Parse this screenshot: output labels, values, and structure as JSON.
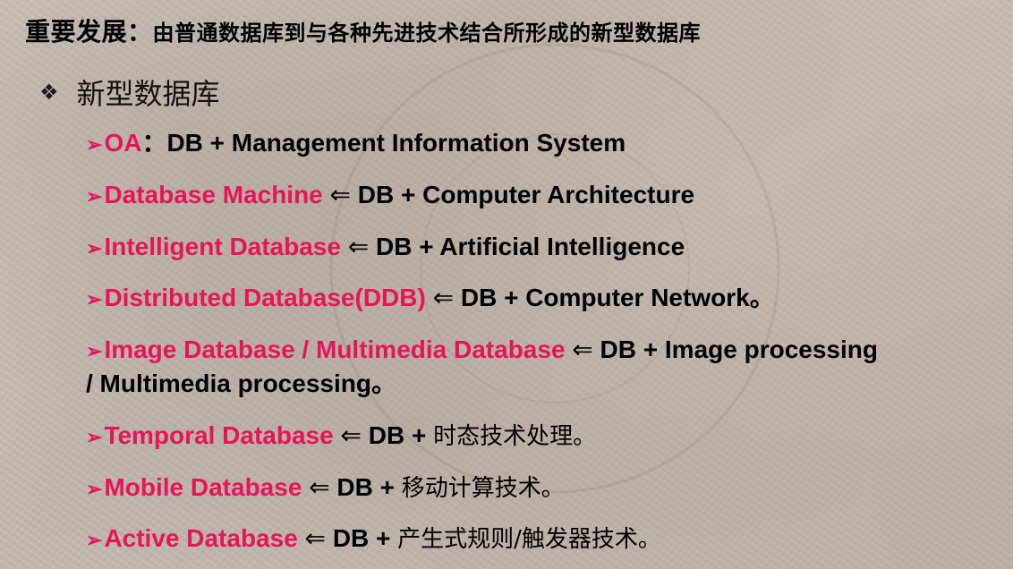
{
  "heading": {
    "main": "重要发展：",
    "sub": "由普通数据库到与各种先进技术结合所形成的新型数据库"
  },
  "section": {
    "bullet_icon": "diamond-bullet-icon",
    "title": "新型数据库"
  },
  "colors": {
    "accent": "#e8145a",
    "text": "#000000"
  },
  "items": [
    {
      "bullet": "➢",
      "name": "OA",
      "sep": "：",
      "rest": "DB + Management Information System",
      "rest2": ""
    },
    {
      "bullet": "➢",
      "name": "Database Machine",
      "sep": " ⇐ ",
      "rest": "DB + Computer Architecture",
      "rest2": ""
    },
    {
      "bullet": "➢",
      "name": "Intelligent Database",
      "sep": " ⇐ ",
      "rest": "DB + Artificial Intelligence",
      "rest2": ""
    },
    {
      "bullet": "➢",
      "name": "Distributed Database(DDB)",
      "sep": " ⇐ ",
      "rest": "DB + Computer Network。",
      "rest2": ""
    },
    {
      "bullet": "➢",
      "name": "Image Database / Multimedia Database",
      "sep": " ⇐ ",
      "rest": "DB + Image processing",
      "rest2": "/ Multimedia processing。"
    },
    {
      "bullet": "➢",
      "name": "Temporal Database",
      "sep": " ⇐ ",
      "rest": "DB + ",
      "rest_zh": "时态技术处理。"
    },
    {
      "bullet": "➢",
      "name": "Mobile Database",
      "sep": " ⇐ ",
      "rest": "DB + ",
      "rest_zh": "移动计算技术。"
    },
    {
      "bullet": "➢",
      "name": "Active Database",
      "sep": " ⇐ ",
      "rest": "DB + ",
      "rest_zh": "产生式规则/触发器技术。"
    }
  ]
}
